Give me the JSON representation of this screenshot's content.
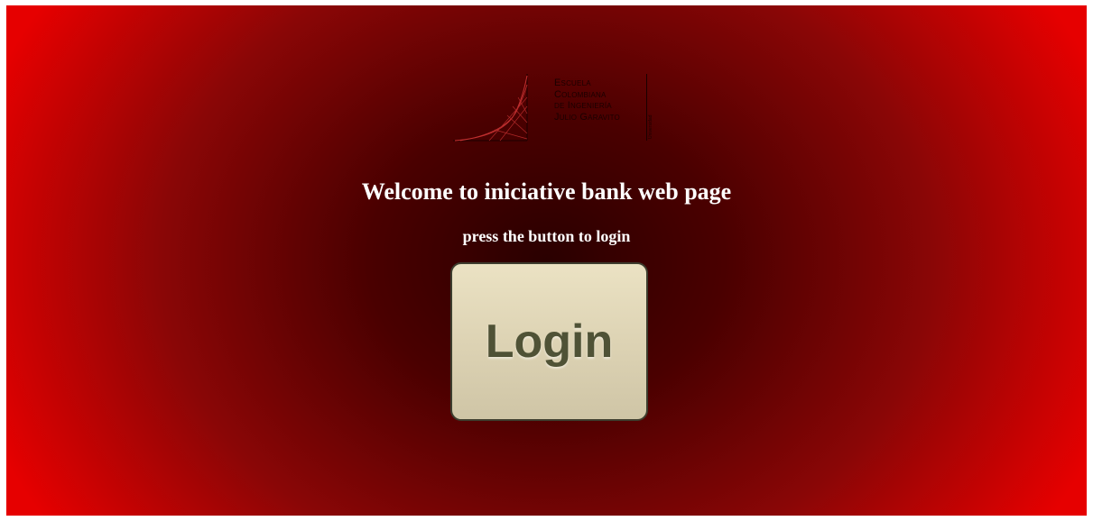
{
  "logo": {
    "lines": [
      "Escuela",
      "Colombiana",
      "de Ingeniería",
      "Julio Garavito"
    ],
    "vertical_text": "Universidad"
  },
  "main": {
    "title": "Welcome to iniciative bank web page",
    "subtitle": "press the button to login",
    "login_label": "Login"
  },
  "colors": {
    "background_edge": "#e60000",
    "background_center": "#2a0000",
    "button_fill": "#ddd3b4",
    "button_text": "#4f5236"
  }
}
